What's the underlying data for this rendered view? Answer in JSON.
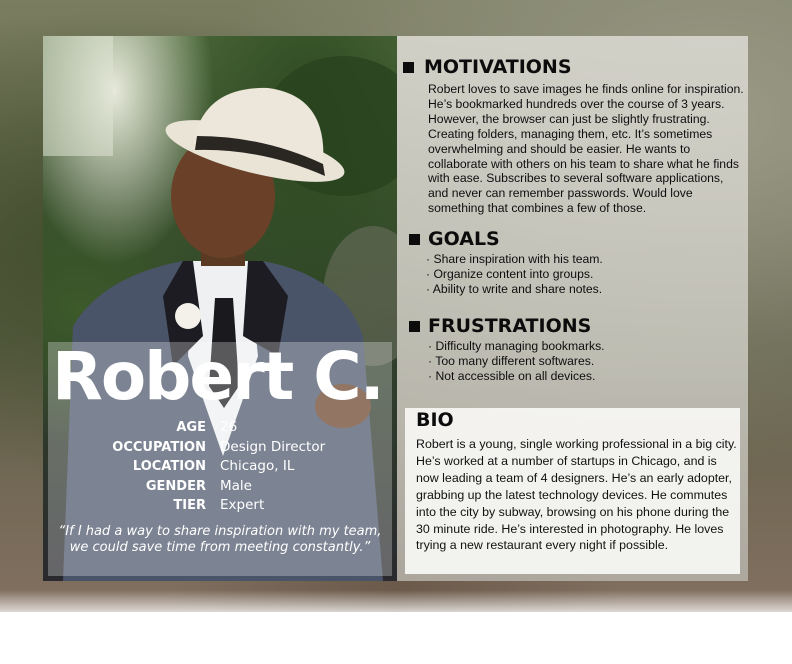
{
  "persona": {
    "name": "Robert C.",
    "facts": [
      {
        "label": "AGE",
        "value": "26"
      },
      {
        "label": "OCCUPATION",
        "value": "Design Director"
      },
      {
        "label": "LOCATION",
        "value": "Chicago, IL"
      },
      {
        "label": "GENDER",
        "value": "Male"
      },
      {
        "label": "TIER",
        "value": "Expert"
      }
    ],
    "quote_line1": "“If I had a way to share inspiration with my team,",
    "quote_line2": "we could save time from meeting constantly.”"
  },
  "motivations": {
    "title": "MOTIVATIONS",
    "text": "Robert loves to save images he finds online for inspiration. He’s bookmarked hundreds over the course of 3 years. However, the browser can just be slightly frustrating. Creating folders, managing them, etc. It’s sometimes overwhelming and should be easier. He wants to collaborate with others on his team to share what he finds with ease. Subscribes to several software applications, and never can remember passwords. Would love something that combines a few of those."
  },
  "goals": {
    "title": "GOALS",
    "items": [
      "Share inspiration with his team.",
      "Organize content into groups.",
      "Ability to write and share notes."
    ]
  },
  "frustrations": {
    "title": "FRUSTRATIONS",
    "items": [
      "Difficulty managing bookmarks.",
      "Too many different softwares.",
      "Not accessible on all devices."
    ]
  },
  "bio": {
    "title": "BIO",
    "text": "Robert is a young, single working professional in a big city. He’s worked at a number of startups in Chicago, and is now leading a team of 4 designers. He’s an early adopter, grabbing up the latest technology devices. He commutes into the city by subway, browsing on his phone during the 30 minute ride. He’s interested in photography. He loves trying a new restaurant every night if possible."
  },
  "colors": {
    "text_dark": "#0c0c0c",
    "name_text": "#ffffff",
    "panel": "#d7d6ce"
  }
}
